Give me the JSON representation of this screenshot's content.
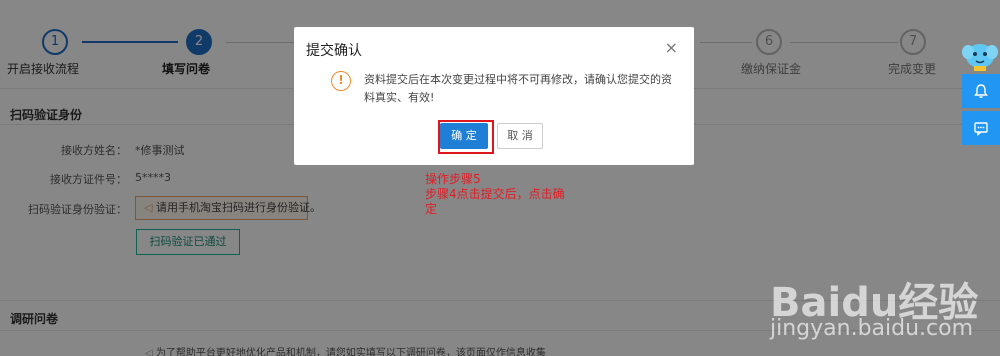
{
  "steps": [
    {
      "number": "1",
      "label": "开启接收流程",
      "state": "done"
    },
    {
      "number": "2",
      "label": "填写问卷",
      "state": "active"
    },
    {
      "number": "6",
      "label": "缴纳保证金",
      "state": "todo"
    },
    {
      "number": "7",
      "label": "完成变更",
      "state": "todo"
    }
  ],
  "identity": {
    "section_title": "扫码验证身份",
    "receiver_name_label": "接收方姓名：",
    "receiver_name_value": "*修事测试",
    "receiver_id_label": "接收方证件号：",
    "receiver_id_value": "5****3",
    "scan_label": "扫码验证身份验证：",
    "scan_notice": "请用手机淘宝扫码进行身份验证。",
    "scan_button": "扫码验证已通过"
  },
  "survey": {
    "section_title": "调研问卷",
    "note": "为了帮助平台更好地优化产品和机制，请您如实填写以下调研问卷，该页面仅作信息收集"
  },
  "modal": {
    "title": "提交确认",
    "close": "×",
    "warn_glyph": "!",
    "message": "资料提交后在本次变更过程中将不可再修改，请确认您提交的资料真实、有效!",
    "confirm": "确 定",
    "cancel": "取 消"
  },
  "annotation": {
    "line1": "操作步骤5",
    "line2": "步骤4点击提交后，点击确定"
  },
  "widgets": {
    "bell_icon": "bell-icon",
    "chat_icon": "chat-icon"
  },
  "watermark": {
    "brand": "Baidu经验",
    "url": "jingyan.baidu.com"
  },
  "colors": {
    "primary": "#1f7fd6",
    "warning": "#f08a2b",
    "annotation": "#e31c24",
    "widget": "#2196f3"
  }
}
